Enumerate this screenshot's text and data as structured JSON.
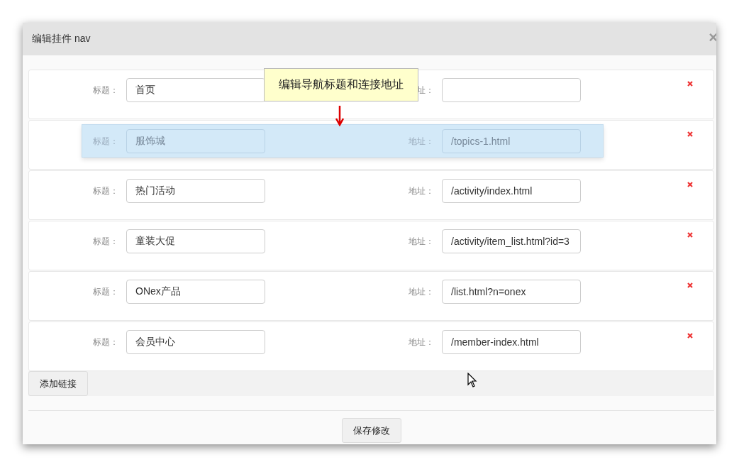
{
  "dialog": {
    "title": "编辑挂件 nav",
    "close": "×"
  },
  "tooltip": {
    "text": "编辑导航标题和连接地址"
  },
  "rows": [
    {
      "title_label": "标题：",
      "title_value": "首页",
      "url_label": "址：",
      "dragging": false
    },
    {
      "title_label": "标题：",
      "title_value": "服饰城",
      "url_label": "地址：",
      "url_value": "/topics-1.html",
      "dragging": true
    },
    {
      "title_label": "标题：",
      "title_value": "热门活动",
      "url_label": "地址：",
      "url_value": "/activity/index.html",
      "dragging": false
    },
    {
      "title_label": "标题：",
      "title_value": "童装大促",
      "url_label": "地址：",
      "url_value": "/activity/item_list.html?id=3",
      "dragging": false
    },
    {
      "title_label": "标题：",
      "title_value": "ONex产品",
      "url_label": "地址：",
      "url_value": "/list.html?n=onex",
      "dragging": false
    },
    {
      "title_label": "标题：",
      "title_value": "会员中心",
      "url_label": "地址：",
      "url_value": "/member-index.html",
      "dragging": false
    }
  ],
  "add_button": "添加链接",
  "save_button": "保存修改"
}
